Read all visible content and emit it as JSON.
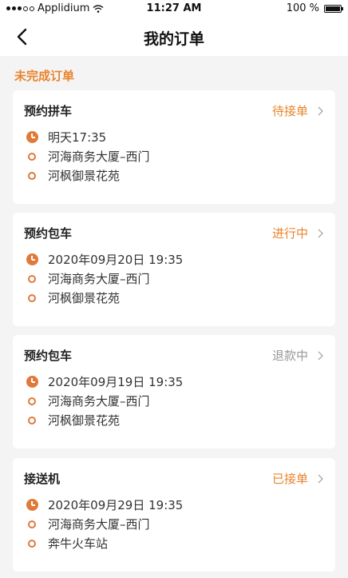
{
  "status_bar": {
    "carrier": "Applidium",
    "time": "11:27 AM",
    "battery": "100 %",
    "battery_level": 1.0
  },
  "nav": {
    "title": "我的订单",
    "back_icon": "chevron-left-icon"
  },
  "section": {
    "title": "未完成订单"
  },
  "colors": {
    "accent": "#e8842d",
    "muted": "#999999",
    "background": "#f4f4f4"
  },
  "orders": [
    {
      "type": "预约拼车",
      "status": "待接单",
      "status_color": "orange",
      "time": "明天17:35",
      "from": "河海商务大厦–西门",
      "to": "河枫御景花苑"
    },
    {
      "type": "预约包车",
      "status": "进行中",
      "status_color": "orange",
      "time": "2020年09月20日 19:35",
      "from": "河海商务大厦–西门",
      "to": "河枫御景花苑"
    },
    {
      "type": "预约包车",
      "status": "退款中",
      "status_color": "gray",
      "time": "2020年09月19日 19:35",
      "from": "河海商务大厦–西门",
      "to": "河枫御景花苑"
    },
    {
      "type": "接送机",
      "status": "已接单",
      "status_color": "orange",
      "time": "2020年09月29日 19:35",
      "from": "河海商务大厦–西门",
      "to": "奔牛火车站"
    }
  ]
}
